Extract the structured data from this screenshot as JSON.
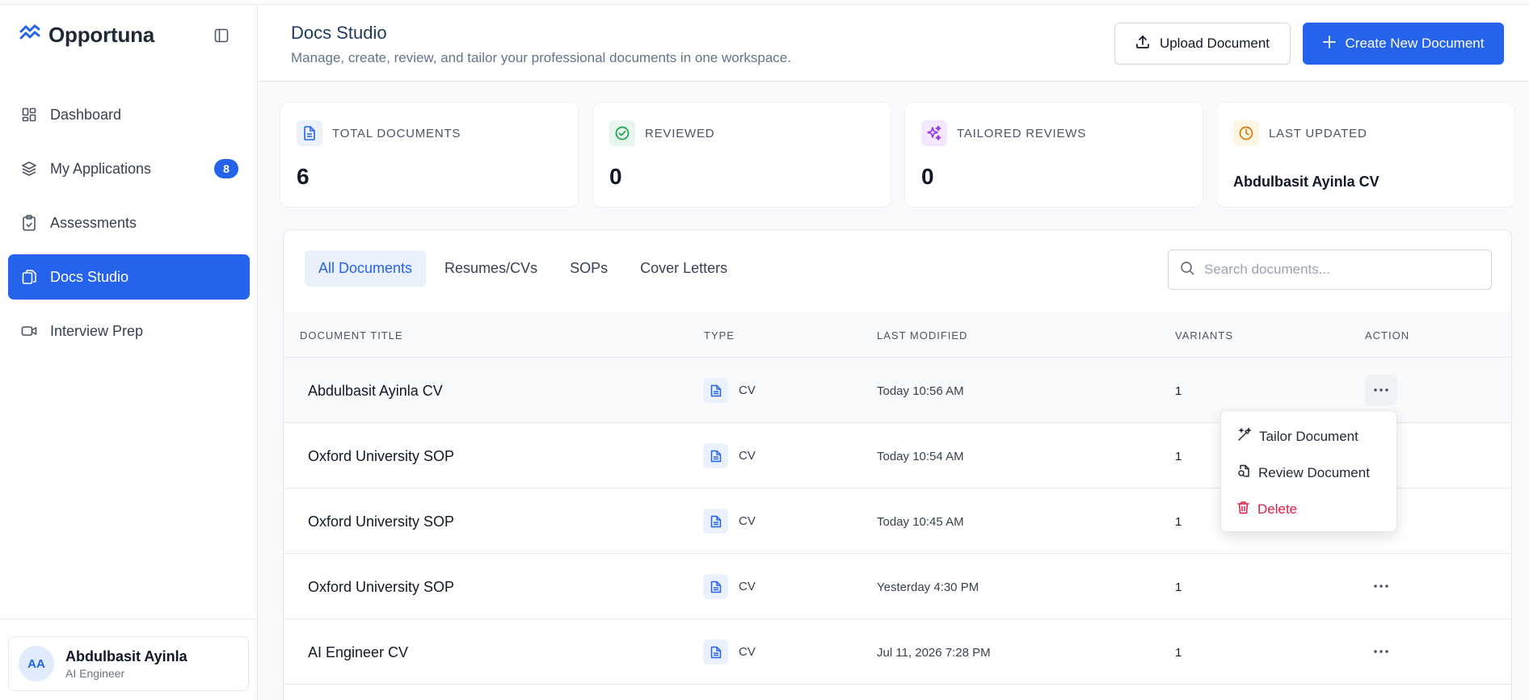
{
  "app": {
    "name": "Opportuna"
  },
  "sidebar": {
    "items": [
      {
        "label": "Dashboard",
        "icon": "dashboard-icon"
      },
      {
        "label": "My Applications",
        "icon": "layers-icon",
        "badge": "8"
      },
      {
        "label": "Assessments",
        "icon": "clipboard-check-icon"
      },
      {
        "label": "Docs Studio",
        "icon": "docs-icon",
        "active": true
      },
      {
        "label": "Interview Prep",
        "icon": "video-icon"
      }
    ],
    "user": {
      "initials": "AA",
      "name": "Abdulbasit Ayinla",
      "role": "AI Engineer"
    }
  },
  "header": {
    "title": "Docs Studio",
    "subtitle": "Manage, create, review, and tailor your professional documents in one workspace.",
    "upload_label": "Upload Document",
    "create_label": "Create New Document"
  },
  "stats": [
    {
      "label": "Total Documents",
      "value": "6",
      "color": "#2563eb",
      "bg": "#eaf1fd"
    },
    {
      "label": "Reviewed",
      "value": "0",
      "color": "#16a34a",
      "bg": "#e8f7ee"
    },
    {
      "label": "Tailored Reviews",
      "value": "0",
      "color": "#9333ea",
      "bg": "#f3e8ff"
    },
    {
      "label": "Last Updated",
      "value": "Abdulbasit Ayinla CV",
      "color": "#d97706",
      "bg": "#fef6e4"
    }
  ],
  "tabs": [
    "All Documents",
    "Resumes/CVs",
    "SOPs",
    "Cover Letters"
  ],
  "search": {
    "placeholder": "Search documents..."
  },
  "table": {
    "columns": [
      "Document Title",
      "Type",
      "Last Modified",
      "Variants",
      "Action"
    ],
    "rows": [
      {
        "title": "Abdulbasit Ayinla CV",
        "type": "CV",
        "modified": "Today 10:56 AM",
        "variants": "1"
      },
      {
        "title": "Oxford University SOP",
        "type": "CV",
        "modified": "Today 10:54 AM",
        "variants": "1"
      },
      {
        "title": "Oxford University SOP",
        "type": "CV",
        "modified": "Today 10:45 AM",
        "variants": "1"
      },
      {
        "title": "Oxford University SOP",
        "type": "CV",
        "modified": "Yesterday 4:30 PM",
        "variants": "1"
      },
      {
        "title": "AI Engineer CV",
        "type": "CV",
        "modified": "Jul 11, 2026 7:28 PM",
        "variants": "1"
      }
    ]
  },
  "action_menu": {
    "items": [
      {
        "label": "Tailor Document",
        "icon": "magic-wand-icon"
      },
      {
        "label": "Review Document",
        "icon": "review-doc-icon"
      },
      {
        "label": "Delete",
        "icon": "trash-icon",
        "danger": true
      }
    ]
  },
  "colors": {
    "primary": "#2563eb",
    "danger": "#e11d48"
  }
}
